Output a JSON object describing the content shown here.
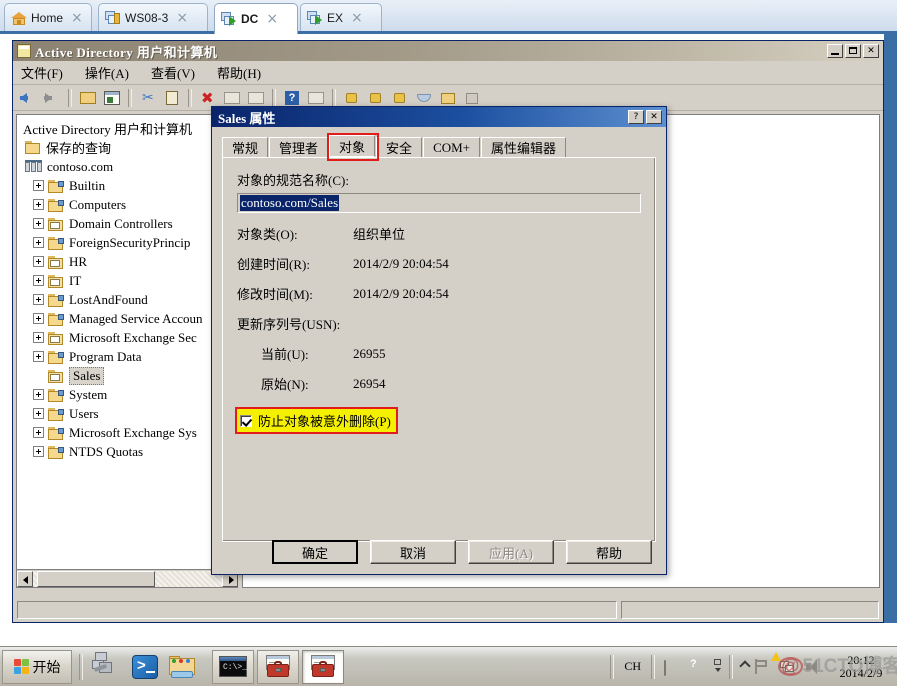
{
  "console_tabs": [
    {
      "label": "Home",
      "icon": "home-icon",
      "active": false,
      "close": "×"
    },
    {
      "label": "WS08-3",
      "icon": "vm-icon",
      "active": false,
      "close": "×"
    },
    {
      "label": "DC",
      "icon": "vm-running-icon",
      "active": true,
      "close": "×"
    },
    {
      "label": "EX",
      "icon": "vm-running-icon",
      "active": false,
      "close": "×"
    }
  ],
  "mmc": {
    "title": "Active Directory 用户和计算机",
    "menu": [
      "文件(F)",
      "操作(A)",
      "查看(V)",
      "帮助(H)"
    ],
    "window_buttons": {
      "minimize": "_",
      "maximize": "□",
      "close": "✕"
    },
    "tree": [
      {
        "label": "Active Directory 用户和计算机",
        "icon": "console-root-icon",
        "expander": "none",
        "indent": 0,
        "selected": false
      },
      {
        "label": "保存的查询",
        "icon": "saved-queries-folder-icon",
        "expander": "none",
        "indent": 1,
        "selected": false
      },
      {
        "label": "contoso.com",
        "icon": "domain-icon",
        "expander": "none",
        "indent": 1,
        "selected": false
      },
      {
        "label": "Builtin",
        "icon": "folder-icon",
        "expander": "plus",
        "indent": 2,
        "selected": false
      },
      {
        "label": "Computers",
        "icon": "folder-icon",
        "expander": "plus",
        "indent": 2,
        "selected": false
      },
      {
        "label": "Domain Controllers",
        "icon": "ou-icon",
        "expander": "plus",
        "indent": 2,
        "selected": false
      },
      {
        "label": "ForeignSecurityPrincip",
        "icon": "folder-icon",
        "expander": "plus",
        "indent": 2,
        "selected": false
      },
      {
        "label": "HR",
        "icon": "ou-icon",
        "expander": "plus",
        "indent": 2,
        "selected": false
      },
      {
        "label": "IT",
        "icon": "ou-icon",
        "expander": "plus",
        "indent": 2,
        "selected": false
      },
      {
        "label": "LostAndFound",
        "icon": "folder-icon",
        "expander": "plus",
        "indent": 2,
        "selected": false
      },
      {
        "label": "Managed Service Accoun",
        "icon": "folder-icon",
        "expander": "plus",
        "indent": 2,
        "selected": false
      },
      {
        "label": "Microsoft Exchange Sec",
        "icon": "ou-icon",
        "expander": "plus",
        "indent": 2,
        "selected": false
      },
      {
        "label": "Program Data",
        "icon": "folder-icon",
        "expander": "plus",
        "indent": 2,
        "selected": false
      },
      {
        "label": "Sales",
        "icon": "ou-icon",
        "expander": "none",
        "indent": 2,
        "selected": true
      },
      {
        "label": "System",
        "icon": "folder-icon",
        "expander": "plus",
        "indent": 2,
        "selected": false
      },
      {
        "label": "Users",
        "icon": "folder-icon",
        "expander": "plus",
        "indent": 2,
        "selected": false
      },
      {
        "label": "Microsoft Exchange Sys",
        "icon": "folder-icon",
        "expander": "plus",
        "indent": 2,
        "selected": false
      },
      {
        "label": "NTDS Quotas",
        "icon": "folder-icon",
        "expander": "plus",
        "indent": 2,
        "selected": false
      }
    ],
    "toolbar_icons": [
      "back-arrow-icon",
      "forward-arrow-icon",
      "sep",
      "up-folder-icon",
      "show-hide-tree-icon",
      "sep",
      "cut-icon",
      "paste-icon",
      "sep",
      "delete-icon",
      "properties-icon",
      "refresh-icon",
      "sep",
      "help-icon",
      "list-icon",
      "sep",
      "find-user-icon",
      "new-user-icon",
      "new-group-icon",
      "new-ou-icon",
      "filter-icon",
      "columns-icon"
    ]
  },
  "dialog": {
    "title": "Sales 属性",
    "titlebar_buttons": {
      "help": "?",
      "close": "✕"
    },
    "tabs": [
      {
        "label": "常规",
        "selected": false
      },
      {
        "label": "管理者",
        "selected": false
      },
      {
        "label": "对象",
        "selected": true,
        "highlighted": true
      },
      {
        "label": "安全",
        "selected": false
      },
      {
        "label": "COM+",
        "selected": false
      },
      {
        "label": "属性编辑器",
        "selected": false
      }
    ],
    "canonical_name_label": "对象的规范名称(C):",
    "canonical_name_value": "contoso.com/Sales",
    "fields": [
      {
        "label": "对象类(O):",
        "value": "组织单位",
        "indent": false
      },
      {
        "label": "创建时间(R):",
        "value": "2014/2/9 20:04:54",
        "indent": false
      },
      {
        "label": "修改时间(M):",
        "value": "2014/2/9 20:04:54",
        "indent": false
      }
    ],
    "usn_label": "更新序列号(USN):",
    "usn_fields": [
      {
        "label": "当前(U):",
        "value": "26955",
        "indent": true
      },
      {
        "label": "原始(N):",
        "value": "26954",
        "indent": true
      }
    ],
    "protect_checkbox": {
      "label": "防止对象被意外删除(P)",
      "checked": true,
      "highlight_color": "#f5f000",
      "outline_color": "#e21b1b"
    },
    "buttons": [
      {
        "label": "确定",
        "default": true,
        "disabled": false
      },
      {
        "label": "取消",
        "default": false,
        "disabled": false
      },
      {
        "label": "应用(A)",
        "default": false,
        "disabled": true
      },
      {
        "label": "帮助",
        "default": false,
        "disabled": false
      }
    ]
  },
  "taskbar": {
    "start_label": "开始",
    "quicklaunch": [
      {
        "name": "server-manager-icon"
      },
      {
        "name": "powershell-icon"
      },
      {
        "name": "explorer-icon"
      }
    ],
    "tasks": [
      {
        "name": "command-prompt-task",
        "active": false
      },
      {
        "name": "mmc-toolbox-task-1",
        "active": false
      },
      {
        "name": "mmc-toolbox-task-2",
        "active": true
      }
    ],
    "tray": {
      "ime": "CH",
      "icons": [
        "keyboard-icon",
        "help-icon",
        "show-desktop-icon",
        "chevron-up-icon",
        "flag-icon",
        "network-warning-icon",
        "volume-icon"
      ],
      "time": "20:12",
      "date": "2014/2/9"
    }
  },
  "watermark": {
    "at": "@",
    "text": "51CTO博客"
  }
}
